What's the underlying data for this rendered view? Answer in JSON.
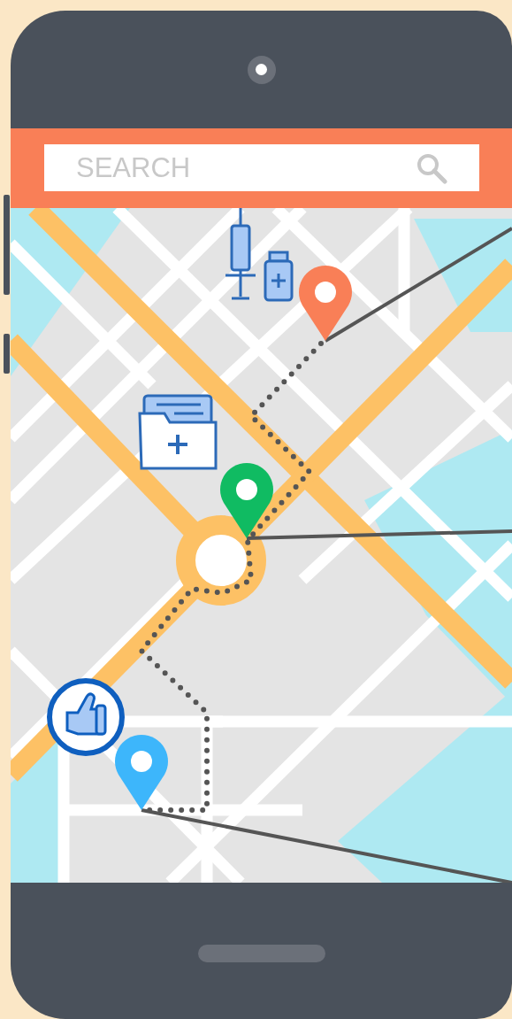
{
  "search": {
    "placeholder": "SEARCH"
  },
  "map": {
    "pins": [
      {
        "color": "#f97f57"
      },
      {
        "color": "#10bb62"
      },
      {
        "color": "#3db6fb"
      }
    ]
  }
}
